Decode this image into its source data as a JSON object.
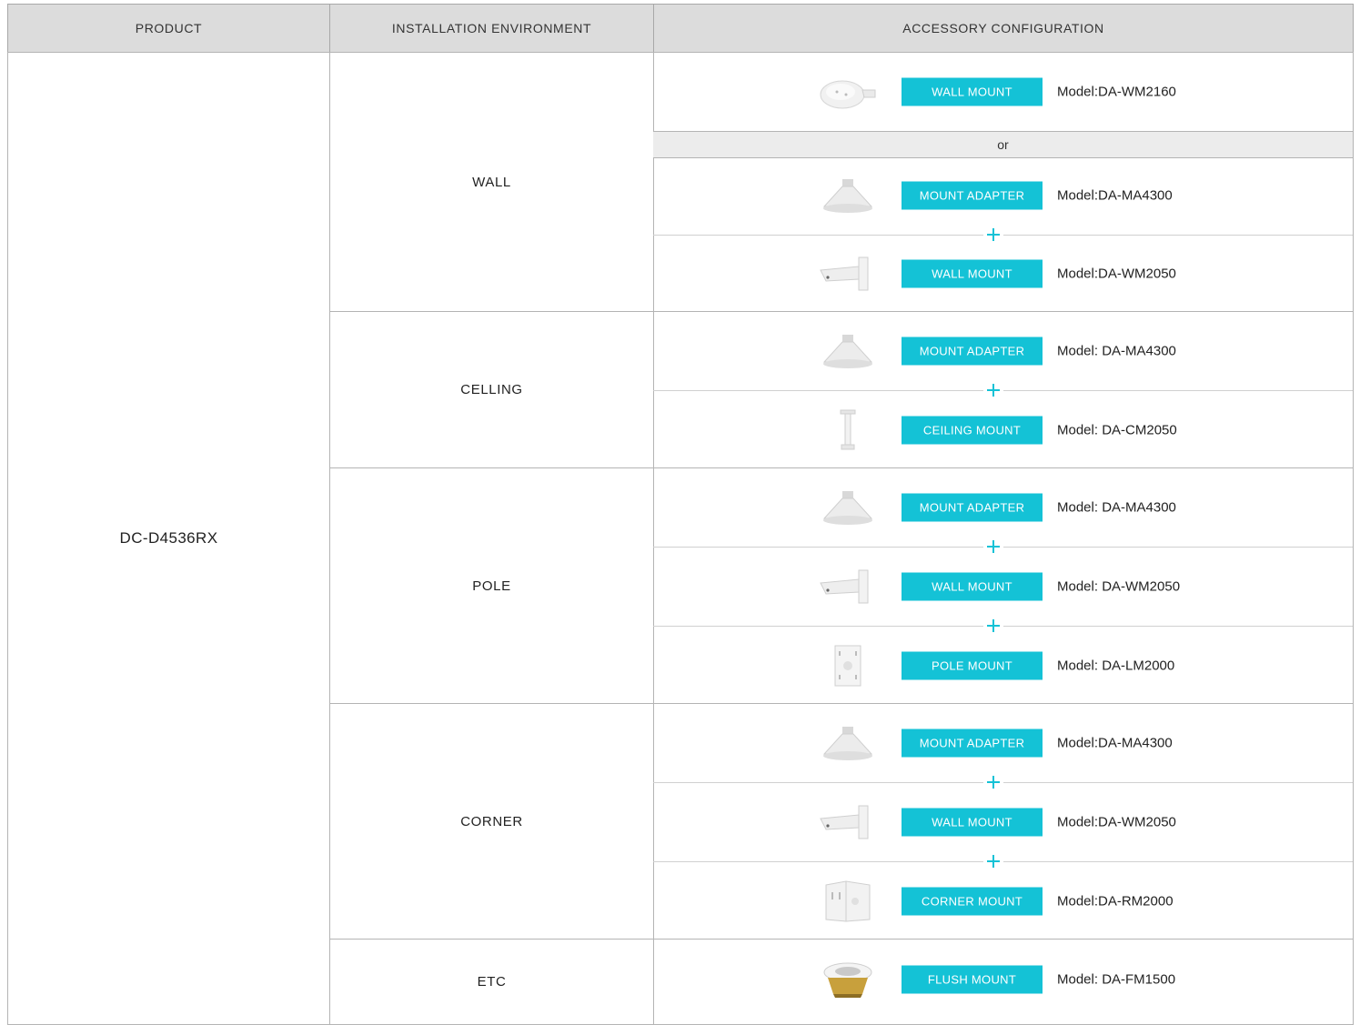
{
  "header": {
    "product": "PRODUCT",
    "environment": "INSTALLATION ENVIRONMENT",
    "accessory": "ACCESSORY CONFIGURATION"
  },
  "product": "DC-D4536RX",
  "or_label": "or",
  "accent_color": "#14c2d6",
  "environments": [
    {
      "name": "WALL",
      "rows": [
        {
          "label": "WALL MOUNT",
          "model": "Model:DA-WM2160",
          "icon": "round-wall-mount-icon"
        },
        {
          "label": "MOUNT ADAPTER",
          "model": "Model:DA-MA4300",
          "icon": "mount-adapter-icon"
        },
        {
          "label": "WALL MOUNT",
          "model": "Model:DA-WM2050",
          "icon": "wall-mount-arm-icon"
        }
      ]
    },
    {
      "name": "CELLING",
      "rows": [
        {
          "label": "MOUNT ADAPTER",
          "model": "Model: DA-MA4300",
          "icon": "mount-adapter-icon"
        },
        {
          "label": "CEILING MOUNT",
          "model": "Model: DA-CM2050",
          "icon": "ceiling-pipe-icon"
        }
      ]
    },
    {
      "name": "POLE",
      "rows": [
        {
          "label": "MOUNT ADAPTER",
          "model": "Model: DA-MA4300",
          "icon": "mount-adapter-icon"
        },
        {
          "label": "WALL MOUNT",
          "model": "Model: DA-WM2050",
          "icon": "wall-mount-arm-icon"
        },
        {
          "label": "POLE MOUNT",
          "model": "Model: DA-LM2000",
          "icon": "pole-plate-icon"
        }
      ]
    },
    {
      "name": "CORNER",
      "rows": [
        {
          "label": "MOUNT ADAPTER",
          "model": "Model:DA-MA4300",
          "icon": "mount-adapter-icon"
        },
        {
          "label": "WALL MOUNT",
          "model": "Model:DA-WM2050",
          "icon": "wall-mount-arm-icon"
        },
        {
          "label": "CORNER MOUNT",
          "model": "Model:DA-RM2000",
          "icon": "corner-bracket-icon"
        }
      ]
    },
    {
      "name": "ETC",
      "rows": [
        {
          "label": "FLUSH MOUNT",
          "model": "Model: DA-FM1500",
          "icon": "flush-mount-icon"
        }
      ]
    }
  ]
}
